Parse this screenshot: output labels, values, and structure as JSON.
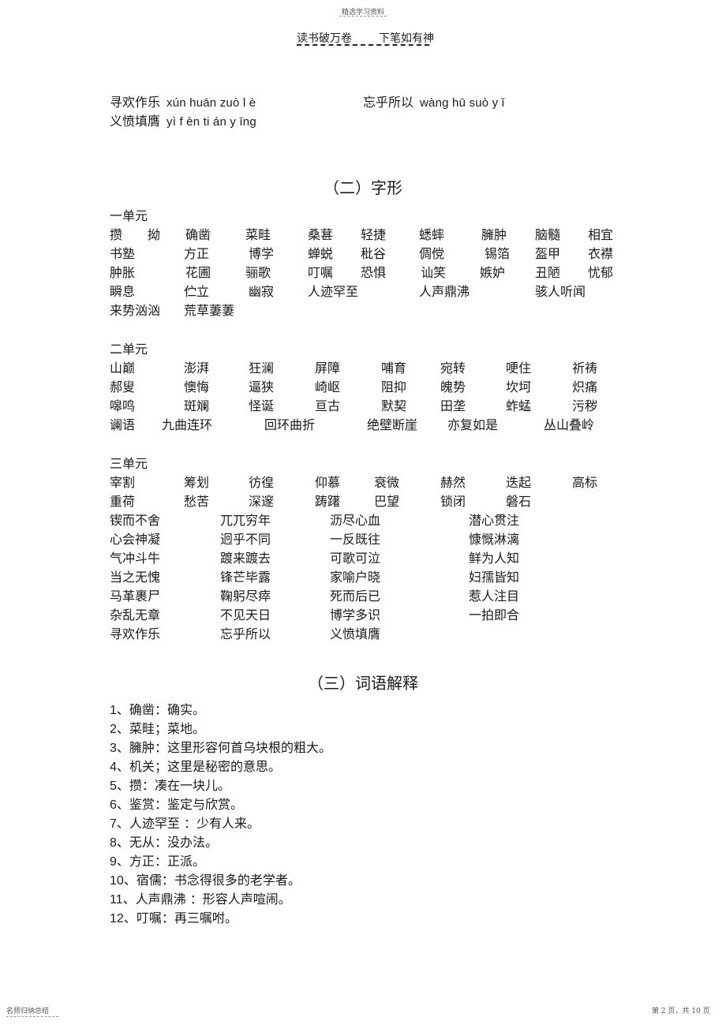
{
  "header": {
    "watermark": "精选学习资料",
    "motto_left": "读书破万卷",
    "motto_right": "下笔如有神"
  },
  "pinyin_section": {
    "items": [
      {
        "word": "寻欢作乐",
        "pinyin": "xún huān zuò l è"
      },
      {
        "word": "忘乎所以",
        "pinyin": "wàng hū suò y ǐ"
      },
      {
        "word": "义愤填膺",
        "pinyin": "yì f èn ti án y īng"
      }
    ]
  },
  "section2": {
    "title": "（二）字形",
    "units": [
      {
        "label": "一单元",
        "rows": [
          [
            "攒",
            "拗",
            "确凿",
            "菜畦",
            "桑葚",
            "轻捷",
            "蟋蟀",
            "臃肿",
            "脑髓",
            "相宜"
          ],
          [
            "书塾",
            "方正",
            "博学",
            "蝉蜕",
            "秕谷",
            "倜傥",
            "锡箔",
            "盔甲",
            "衣襟"
          ],
          [
            "肿胀",
            "花圃",
            "骊歌",
            "叮嘱",
            "恐惧",
            "讪笑",
            "嫉妒",
            "丑陋",
            "忧郁"
          ],
          [
            "瞬息",
            "伫立",
            "幽寂",
            "人迹罕至",
            "人声鼎沸",
            "骇人听闻"
          ],
          [
            "来势汹汹",
            "荒草萋萋"
          ]
        ]
      },
      {
        "label": "二单元",
        "rows": [
          [
            "山巅",
            "澎湃",
            "狂澜",
            "屏障",
            "哺育",
            "宛转",
            "哽住",
            "祈祷"
          ],
          [
            "郝叟",
            "懊悔",
            "逼狭",
            "崎岖",
            "阻抑",
            "魄势",
            "坎坷",
            "炽痛"
          ],
          [
            "嗥鸣",
            "斑斓",
            "怪诞",
            "亘古",
            "默契",
            "田垄",
            "蚱蜢",
            "污秽"
          ],
          [
            "谰语",
            "九曲连环",
            "回环曲折",
            "绝壁断崖",
            "亦复如是",
            "丛山叠岭"
          ]
        ]
      },
      {
        "label": "三单元",
        "rows": [
          [
            "宰割",
            "筹划",
            "彷徨",
            "仰慕",
            "衰微",
            "赫然",
            "迭起",
            "高标"
          ],
          [
            "重荷",
            "愁苦",
            "深邃",
            "踌躇",
            "巴望",
            "锁闭",
            "磐石"
          ]
        ],
        "idiom_rows": [
          [
            "锲而不舍",
            "兀兀穷年",
            "沥尽心血",
            "潜心贯注"
          ],
          [
            "心会神凝",
            "迥乎不同",
            "一反既往",
            "慷慨淋漓"
          ],
          [
            "气冲斗牛",
            "踱来踱去",
            "可歌可泣",
            "鲜为人知"
          ],
          [
            "当之无愧",
            "锋芒毕露",
            "家喻户晓",
            "妇孺皆知"
          ],
          [
            "马革裹尸",
            "鞠躬尽瘁",
            "死而后已",
            "惹人注目"
          ],
          [
            "杂乱无章",
            "不见天日",
            "博学多识",
            "一拍即合"
          ],
          [
            "寻欢作乐",
            "忘乎所以",
            "义愤填膺"
          ]
        ]
      }
    ]
  },
  "section3": {
    "title": "（三）词语解释",
    "definitions": [
      {
        "num": "1",
        "term": "确凿",
        "sep": "：",
        "meaning": "确实。"
      },
      {
        "num": "2",
        "term": "菜畦",
        "sep": "；",
        "meaning": "菜地。"
      },
      {
        "num": "3",
        "term": "臃肿",
        "sep": "：",
        "meaning": "这里形容何首乌块根的粗大。"
      },
      {
        "num": "4",
        "term": "机关",
        "sep": "；",
        "meaning": "这里是秘密的意思。"
      },
      {
        "num": "5",
        "term": "攒",
        "sep": "：",
        "meaning": "凑在一块儿。"
      },
      {
        "num": "6",
        "term": "鉴赏",
        "sep": "：",
        "meaning": "鉴定与欣赏。"
      },
      {
        "num": "7",
        "term": "人迹罕至",
        "sep": " ：",
        "meaning": "少有人来。"
      },
      {
        "num": "8",
        "term": "无从",
        "sep": "：",
        "meaning": "没办法。"
      },
      {
        "num": "9",
        "term": "方正",
        "sep": "：",
        "meaning": "正派。"
      },
      {
        "num": "10",
        "term": "宿儒",
        "sep": "：",
        "meaning": "书念得很多的老学者。"
      },
      {
        "num": "11",
        "term": "人声鼎沸",
        "sep": " ：",
        "meaning": "形容人声喧闹。"
      },
      {
        "num": "12",
        "term": "叮嘱",
        "sep": "：",
        "meaning": "再三嘱咐。"
      }
    ]
  },
  "footer": {
    "left": "名师归纳总结",
    "right": "第 2 页，共 10 页"
  }
}
